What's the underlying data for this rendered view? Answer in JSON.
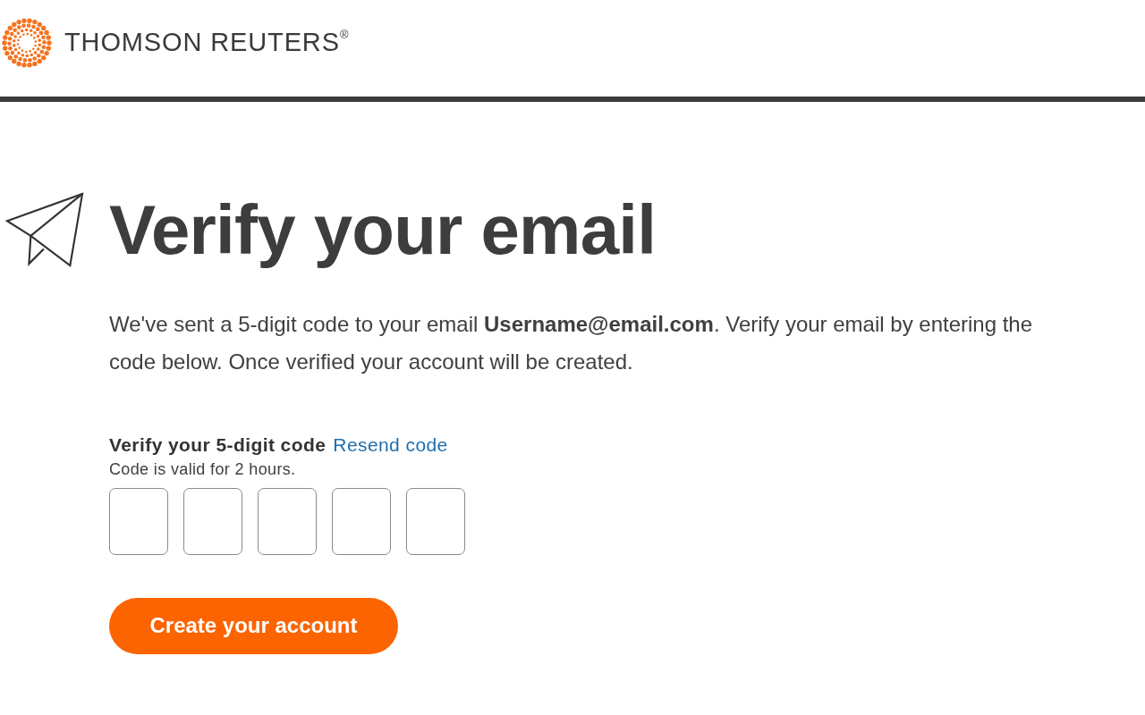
{
  "header": {
    "brand": "THOMSON REUTERS$^{®}$"
  },
  "heading": "Verify your email",
  "message": "We've sent a 5-digit code to your email **Username@email.com**. Verify your email by entering the code below. Once verified your account will be created.",
  "code_field": {
    "label": "Verify your 5-digit code",
    "link": "Resend code",
    "hint": "Code is valid for 2 hours.",
    "digits": [
      {
        "kind": "digit"
      },
      {
        "kind": "digit"
      },
      {
        "kind": "digit"
      },
      {
        "kind": "digit"
      },
      {
        "kind": "digit"
      }
    ]
  },
  "submit_button": "Create your account"
}
